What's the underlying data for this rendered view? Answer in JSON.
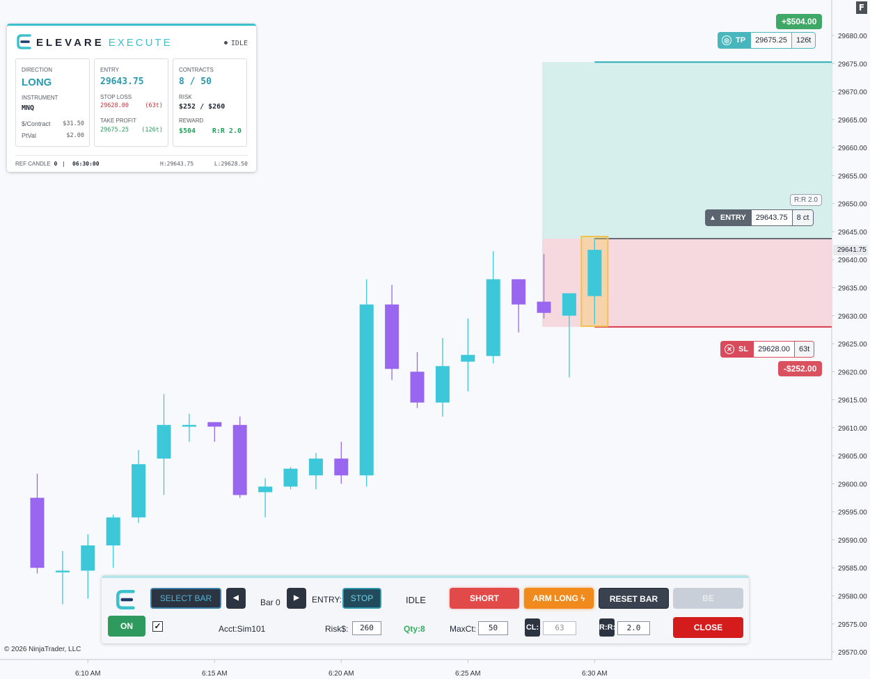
{
  "brand": {
    "name": "ELEVARE",
    "sub": "EXECUTE",
    "status": "IDLE"
  },
  "info": {
    "direction_label": "DIRECTION",
    "direction": "LONG",
    "instrument_label": "INSTRUMENT",
    "instrument": "MNQ",
    "per_contract_label": "$/Contract",
    "per_contract": "$31.50",
    "ptval_label": "PtVal",
    "ptval": "$2.00",
    "entry_label": "ENTRY",
    "entry": "29643.75",
    "stop_label": "STOP LOSS",
    "stop": "29628.00",
    "stop_ticks": "(63t)",
    "tp_label": "TAKE PROFIT",
    "tp": "29675.25",
    "tp_ticks": "(126t)",
    "contracts_label": "CONTRACTS",
    "contracts": "8 / 50",
    "risk_label": "RISK",
    "risk": "$252 / $260",
    "reward_label": "REWARD",
    "reward": "$504",
    "rr": "R:R 2.0",
    "ref_label": "REF CANDLE",
    "ref_value": "0",
    "ref_time": "06:30:00",
    "high": "H:29643.75",
    "low": "L:29628.50"
  },
  "tags": {
    "tp": {
      "label": "TP",
      "price": "29675.25",
      "count": "126t",
      "pnl": "+$504.00"
    },
    "entry": {
      "label": "ENTRY",
      "price": "29643.75",
      "count": "8 ct",
      "rr": "R:R 2.0"
    },
    "sl": {
      "label": "SL",
      "price": "29628.00",
      "count": "63t",
      "pnl": "-$252.00"
    },
    "current_price": "29641.75"
  },
  "axis": {
    "y_ticks": [
      "29680.00",
      "29675.00",
      "29670.00",
      "29665.00",
      "29660.00",
      "29655.00",
      "29650.00",
      "29645.00",
      "29640.00",
      "29635.00",
      "29630.00",
      "29625.00",
      "29620.00",
      "29615.00",
      "29610.00",
      "29605.00",
      "29600.00",
      "29595.00",
      "29590.00",
      "29585.00",
      "29580.00",
      "29575.00",
      "29570.00"
    ],
    "x_ticks": [
      "6:10 AM",
      "6:15 AM",
      "6:20 AM",
      "6:25 AM",
      "6:30 AM"
    ]
  },
  "copyright": "© 2026 NinjaTrader, LLC",
  "controls": {
    "select_bar": "SELECT BAR",
    "bar_label": "Bar 0",
    "entry_label": "ENTRY:",
    "entry_mode": "STOP",
    "state": "IDLE",
    "short": "SHORT",
    "arm_long": "ARM LONG",
    "reset_bar": "RESET BAR",
    "be": "BE",
    "on": "ON",
    "check": "✓",
    "account": "Acct:Sim101",
    "risk_label": "Risk$:",
    "risk_value": "260",
    "qty": "Qty:8",
    "maxct_label": "MaxCt:",
    "maxct_value": "50",
    "cl_label": "CL:",
    "cl_value": "63",
    "rr_label": "R:R:",
    "rr_value": "2.0",
    "close": "CLOSE",
    "prev": "◀",
    "next": "▶"
  },
  "colors": {
    "up": "#3cc8d8",
    "down": "#9966f0",
    "tp_zone": "#d6efec",
    "sl_zone": "#f5d9df",
    "accent": "#3cc0cc"
  },
  "chart_data": {
    "type": "candlestick",
    "x_labels": [
      "6:10 AM",
      "6:15 AM",
      "6:20 AM",
      "6:25 AM",
      "6:30 AM"
    ],
    "ylim": [
      29570,
      29682
    ],
    "entry": 29643.75,
    "stop": 29628.0,
    "take_profit": 29675.25,
    "current": 29641.75,
    "candles": [
      {
        "o": 29597.5,
        "h": 29601.8,
        "l": 29584.0,
        "c": 29585.0
      },
      {
        "o": 29584.5,
        "h": 29588.0,
        "l": 29578.5,
        "c": 29584.5
      },
      {
        "o": 29584.5,
        "h": 29591.0,
        "l": 29579.5,
        "c": 29589.0
      },
      {
        "o": 29589.0,
        "h": 29594.5,
        "l": 29585.0,
        "c": 29594.0
      },
      {
        "o": 29594.0,
        "h": 29606.0,
        "l": 29593.0,
        "c": 29603.5
      },
      {
        "o": 29604.5,
        "h": 29616.0,
        "l": 29598.0,
        "c": 29610.5
      },
      {
        "o": 29610.5,
        "h": 29612.5,
        "l": 29607.5,
        "c": 29610.5
      },
      {
        "o": 29611.0,
        "h": 29611.0,
        "l": 29607.5,
        "c": 29610.2
      },
      {
        "o": 29610.5,
        "h": 29612.0,
        "l": 29597.5,
        "c": 29598.0
      },
      {
        "o": 29598.5,
        "h": 29601.0,
        "l": 29594.0,
        "c": 29599.5
      },
      {
        "o": 29599.5,
        "h": 29603.0,
        "l": 29599.0,
        "c": 29602.7
      },
      {
        "o": 29601.5,
        "h": 29605.5,
        "l": 29599.0,
        "c": 29604.5
      },
      {
        "o": 29604.5,
        "h": 29607.5,
        "l": 29600.0,
        "c": 29601.5
      },
      {
        "o": 29601.5,
        "h": 29636.5,
        "l": 29599.5,
        "c": 29632.0
      },
      {
        "o": 29632.0,
        "h": 29635.5,
        "l": 29618.5,
        "c": 29620.5
      },
      {
        "o": 29620.0,
        "h": 29623.5,
        "l": 29613.5,
        "c": 29614.5
      },
      {
        "o": 29614.5,
        "h": 29626.0,
        "l": 29612.0,
        "c": 29621.0
      },
      {
        "o": 29621.8,
        "h": 29629.5,
        "l": 29616.5,
        "c": 29623.0
      },
      {
        "o": 29622.8,
        "h": 29641.5,
        "l": 29621.5,
        "c": 29636.5
      },
      {
        "o": 29636.5,
        "h": 29636.5,
        "l": 29627.0,
        "c": 29632.0
      },
      {
        "o": 29632.5,
        "h": 29641.0,
        "l": 29629.5,
        "c": 29630.5
      },
      {
        "o": 29630.0,
        "h": 29634.0,
        "l": 29619.0,
        "c": 29634.0
      },
      {
        "o": 29633.5,
        "h": 29643.75,
        "l": 29628.5,
        "c": 29641.75
      }
    ]
  }
}
